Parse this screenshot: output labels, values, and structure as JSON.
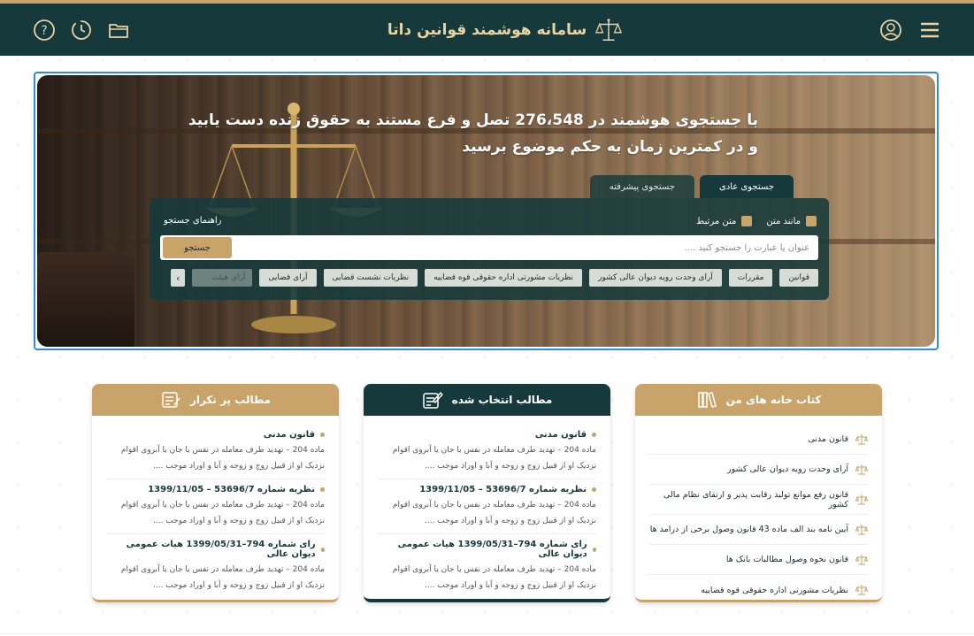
{
  "header": {
    "brand_title": "سامانه هوشمند قوانین داتا",
    "icons": [
      "help-icon",
      "history-icon",
      "folder-icon",
      "user-icon",
      "menu-icon"
    ]
  },
  "hero": {
    "title": "با جستجوی هوشمند در 276،548 تصل و فرع مستند به حقوق زنده دست یابید و در کمترین زمان به حکم موضوع برسید",
    "tabs": {
      "normal": "جستجوی عادی",
      "advanced": "جستجوی پیشرفته"
    },
    "options": {
      "similar_text": "مانند متن",
      "related_text": "متن مرتبط"
    },
    "guide_label": "راهنمای جستجو",
    "search": {
      "placeholder": "عنوان یا عبارت را جستجو کنید ....",
      "button_label": "جستجو"
    },
    "categories": [
      "قوانین",
      "مقررات",
      "آرای وحدت رویه دیوان عالی کشور",
      "نظریات مشورتی اداره حقوقی قوه قضاییه",
      "نظریات نشست قضایی",
      "آرای قضایی",
      "آرای هیئت"
    ]
  },
  "cards": {
    "my_books": {
      "title": "کتاب خانه های من",
      "items": [
        "قانون مدنی",
        "آرای وحدت رویه دیوان عالی کشور",
        "قانون رفع موانع تولید رقابت پذیر و ارتقای نظام مالی کشور",
        "آیین نامه بند الف ماده 43 قانون وصول برخی از درامد ها",
        "قانون نحوه وصول مطالبات بانک ها",
        "نظریات مشورتی اداره حقوقی قوه قضاییه"
      ]
    },
    "selected": {
      "title": "مطالب انتخاب شده",
      "items": [
        {
          "title": "قانون مدنی",
          "line1": "ماده 204 – تهدید طرف معامله در نفس یا جان یا آبروی اقوام",
          "line2": "نزدیک  او از قبیل زوج و زوجه و آبا و اوراد موجب ...."
        },
        {
          "title": "نظریه شماره 53696/7 – 1399/11/05",
          "line1": "ماده 204 – تهدید طرف معامله در نفس یا جان یا آبروی اقوام",
          "line2": "نزدیک  او از قبیل زوج و زوجه و آبا و اوراد موجب ...."
        },
        {
          "title": "رای شماره 794–1399/05/31 هیات عمومی دیوان عالی",
          "line1": "ماده 204 – تهدید طرف معامله در نفس یا جان یا آبروی اقوام",
          "line2": "نزدیک  او از قبیل زوج و زوجه و آبا و اوراد موجب ...."
        }
      ]
    },
    "frequent": {
      "title": "مطالب پر تکرار",
      "items": [
        {
          "title": "قانون مدنی",
          "line1": "ماده 204 – تهدید طرف معامله در نفس یا جان یا آبروی اقوام",
          "line2": "نزدیک  او از قبیل زوج و زوجه و آبا و اوراد موجب ...."
        },
        {
          "title": "نظریه شماره 53696/7 – 1399/11/05",
          "line1": "ماده 204 – تهدید طرف معامله در نفس یا جان یا آبروی اقوام",
          "line2": "نزدیک  او از قبیل زوج و زوجه و آبا و اوراد موجب ...."
        },
        {
          "title": "رای شماره 794–1399/05/31 هیات عمومی دیوان عالی",
          "line1": "ماده 204 – تهدید طرف معامله در نفس یا جان یا آبروی اقوام",
          "line2": "نزدیک  او از قبیل زوج و زوجه و آبا و اوراد موجب ...."
        }
      ]
    }
  },
  "colors": {
    "primary_dark": "#163a3b",
    "accent_gold": "#c8a36a",
    "selection_blue": "#2d8de4"
  }
}
